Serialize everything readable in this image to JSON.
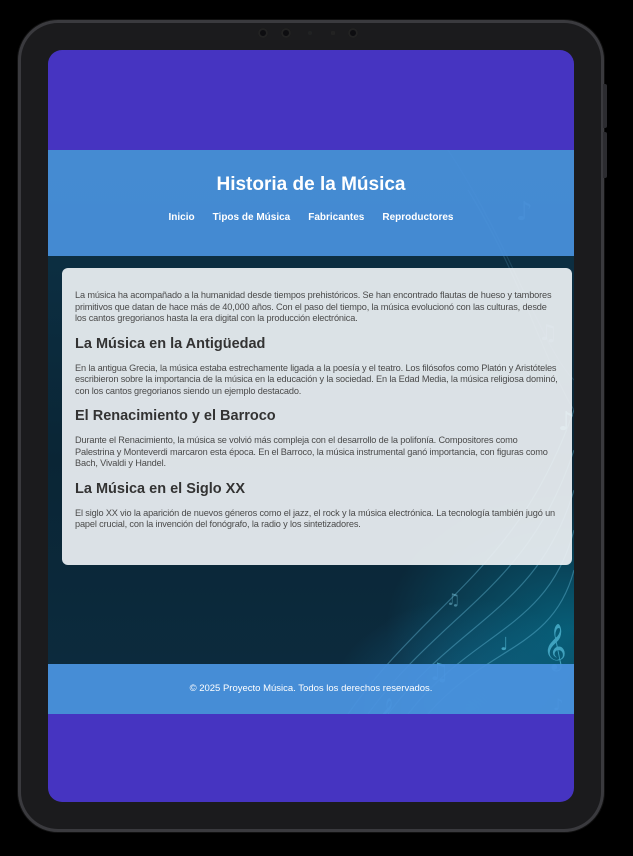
{
  "site": {
    "title": "Historia de la Música"
  },
  "nav": {
    "items": [
      {
        "label": "Inicio"
      },
      {
        "label": "Tipos de Música"
      },
      {
        "label": "Fabricantes"
      },
      {
        "label": "Reproductores"
      }
    ]
  },
  "content": {
    "intro": "La música ha acompañado a la humanidad desde tiempos prehistóricos. Se han encontrado flautas de hueso y tambores primitivos que datan de hace más de 40,000 años. Con el paso del tiempo, la música evolucionó con las culturas, desde los cantos gregorianos hasta la era digital con la producción electrónica.",
    "sections": [
      {
        "heading": "La Música en la Antigüedad",
        "text": "En la antigua Grecia, la música estaba estrechamente ligada a la poesía y el teatro. Los filósofos como Platón y Aristóteles escribieron sobre la importancia de la música en la educación y la sociedad. En la Edad Media, la música religiosa dominó, con los cantos gregorianos siendo un ejemplo destacado."
      },
      {
        "heading": "El Renacimiento y el Barroco",
        "text": "Durante el Renacimiento, la música se volvió más compleja con el desarrollo de la polifonía. Compositores como Palestrina y Monteverdi marcaron esta época. En el Barroco, la música instrumental ganó importancia, con figuras como Bach, Vivaldi y Handel."
      },
      {
        "heading": "La Música en el Siglo XX",
        "text": "El siglo XX vio la aparición de nuevos géneros como el jazz, el rock y la música electrónica. La tecnología también jugó un papel crucial, con la invención del fonógrafo, la radio y los sintetizadores."
      }
    ]
  },
  "footer": {
    "text": "© 2025 Proyecto Música. Todos los derechos reservados."
  },
  "colors": {
    "screen_bg": "#4634c1",
    "header_bg": "#4a92de",
    "page_bg": "#0d3348",
    "card_bg": "#eceff3",
    "device_frame": "#1b1b1d"
  },
  "icons": {
    "background_decoration": "music-notes-icon"
  }
}
